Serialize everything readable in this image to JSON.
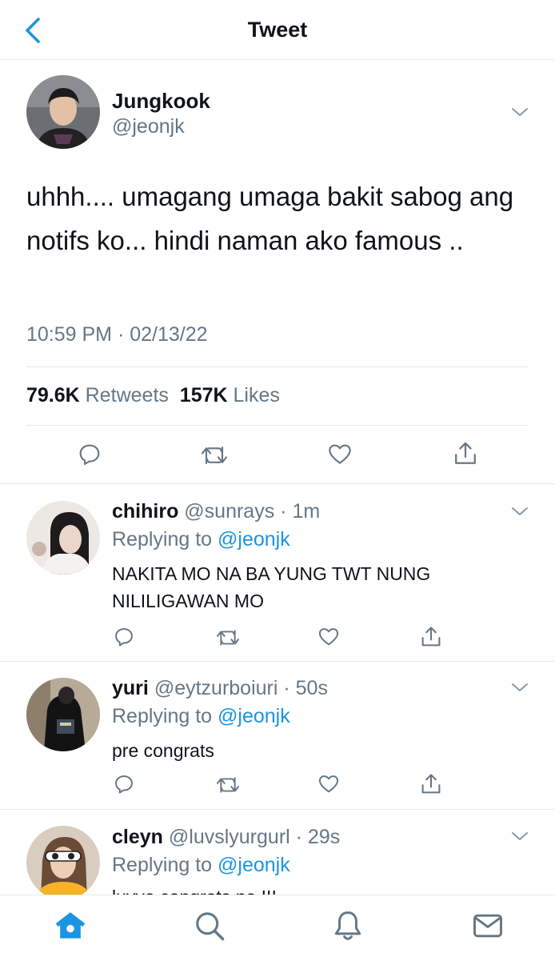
{
  "header": {
    "title": "Tweet"
  },
  "tweet": {
    "author_name": "Jungkook",
    "author_handle": "@jeonjk",
    "text": "uhhh.... umagang umaga bakit sabog ang notifs ko... hindi naman ako famous ..",
    "timestamp": "10:59 PM · 02/13/22",
    "retweets_count": "79.6K",
    "retweets_label": "Retweets",
    "likes_count": "157K",
    "likes_label": "Likes"
  },
  "replies": [
    {
      "name": "chihiro",
      "handle": "@sunrays",
      "time": "· 1m",
      "replying_prefix": "Replying to",
      "replying_handle": "@jeonjk",
      "text": "NAKITA MO NA BA YUNG TWT NUNG NILILIGAWAN MO"
    },
    {
      "name": "yuri",
      "handle": "@eytzurboiuri",
      "time": "· 50s",
      "replying_prefix": "Replying to",
      "replying_handle": "@jeonjk",
      "text": "pre congrats"
    },
    {
      "name": "cleyn",
      "handle": "@luvslyurgurl",
      "time": "· 29s",
      "replying_prefix": "Replying to",
      "replying_handle": "@jeonjk",
      "text": "luvve congrats na !!!"
    }
  ],
  "tabbar": {
    "icons": [
      "home-icon",
      "search-icon",
      "notifications-icon",
      "messages-icon"
    ],
    "active": "home-icon"
  },
  "colors": {
    "accent": "#1b95e0",
    "muted": "#657786",
    "divider": "#e6e8ea"
  }
}
